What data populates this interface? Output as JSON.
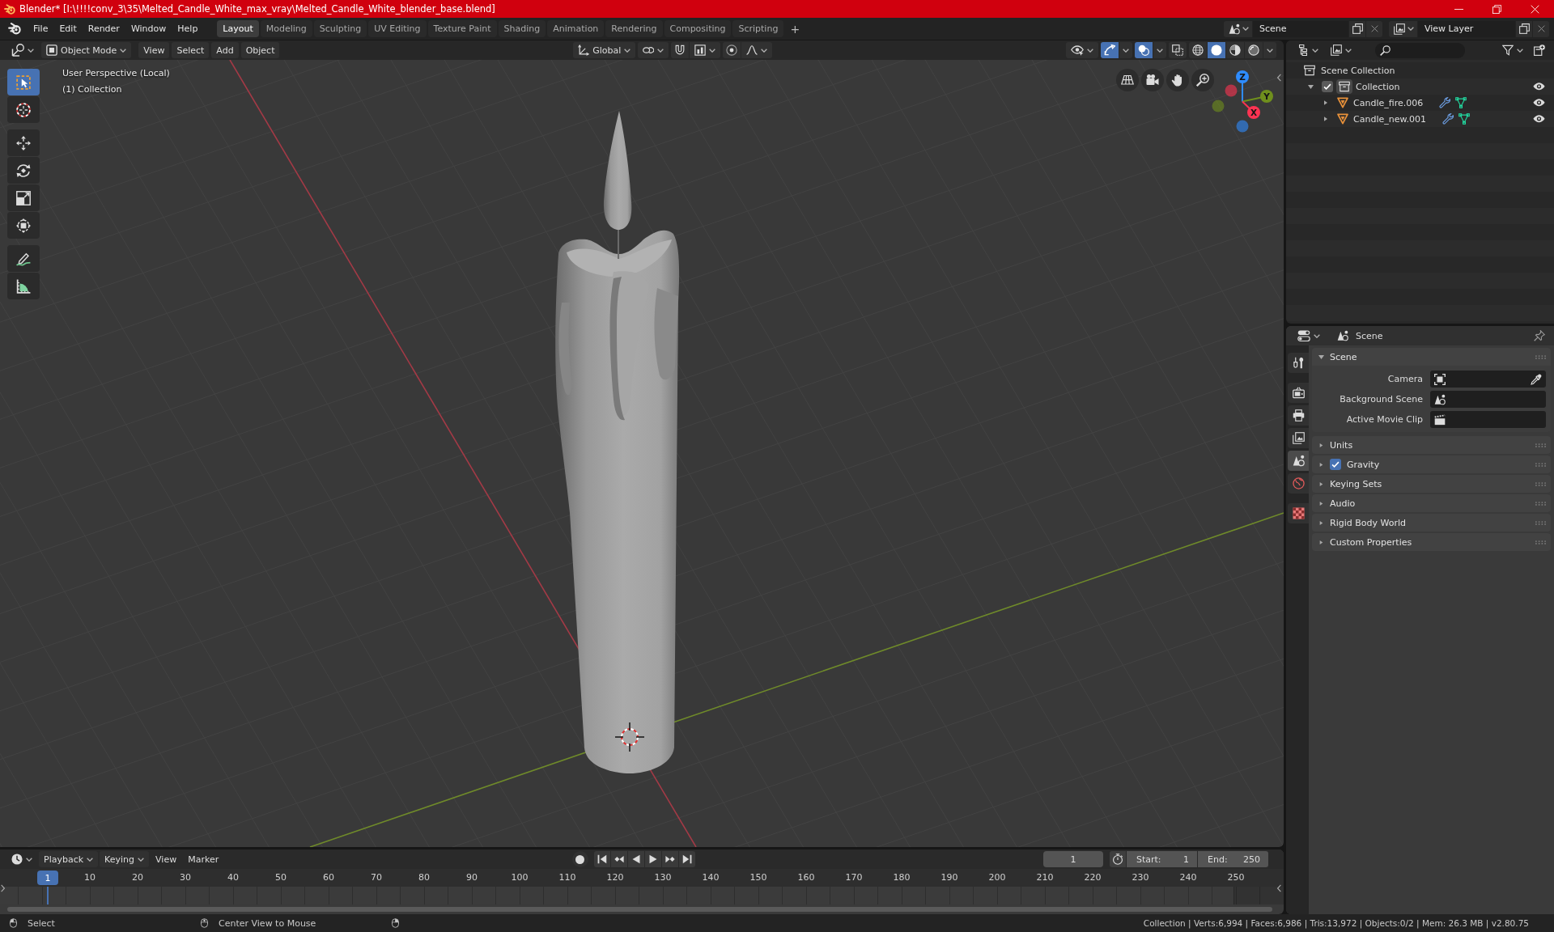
{
  "window": {
    "title": "Blender* [I:\\!!!!conv_3\\35\\Melted_Candle_White_max_vray\\Melted_Candle_White_blender_base.blend]"
  },
  "menu": [
    "File",
    "Edit",
    "Render",
    "Window",
    "Help"
  ],
  "workspaces": [
    {
      "label": "Layout",
      "selected": true
    },
    {
      "label": "Modeling",
      "selected": false
    },
    {
      "label": "Sculpting",
      "selected": false
    },
    {
      "label": "UV Editing",
      "selected": false
    },
    {
      "label": "Texture Paint",
      "selected": false
    },
    {
      "label": "Shading",
      "selected": false
    },
    {
      "label": "Animation",
      "selected": false
    },
    {
      "label": "Rendering",
      "selected": false
    },
    {
      "label": "Compositing",
      "selected": false
    },
    {
      "label": "Scripting",
      "selected": false
    }
  ],
  "add_workspace": "+",
  "scene": {
    "value": "Scene"
  },
  "view_layer": {
    "value": "View Layer"
  },
  "viewport": {
    "header": {
      "mode": "Object Mode",
      "menus": [
        "View",
        "Select",
        "Add",
        "Object"
      ],
      "orientation": "Global",
      "gizmos": {
        "on": true
      },
      "overlays": {
        "on": true
      },
      "xray": {
        "on": false
      },
      "shading": [
        {
          "kind": "wireframe",
          "selected": false
        },
        {
          "kind": "solid",
          "selected": true
        },
        {
          "kind": "material",
          "selected": false
        },
        {
          "kind": "rendered",
          "selected": false
        }
      ]
    },
    "info": [
      "User Perspective (Local)",
      "(1) Collection"
    ],
    "tool_groups": [
      [
        {
          "kind": "select",
          "selected": true
        },
        {
          "kind": "cursor",
          "selected": false
        }
      ],
      [
        {
          "kind": "move",
          "selected": false
        },
        {
          "kind": "rotate",
          "selected": false
        },
        {
          "kind": "scale",
          "selected": false
        },
        {
          "kind": "transform",
          "selected": false
        }
      ],
      [
        {
          "kind": "annotate",
          "selected": false
        },
        {
          "kind": "measure",
          "selected": false
        }
      ]
    ],
    "navigation": [
      {
        "kind": "grid"
      },
      {
        "kind": "camera"
      },
      {
        "kind": "pan"
      },
      {
        "kind": "zoom"
      }
    ],
    "gizmo_axes": [
      {
        "label": "Z",
        "color": "#2e8cff"
      },
      {
        "label": "Y",
        "color": "#6f8f1d"
      },
      {
        "label": "X",
        "color": "#ff3352"
      }
    ]
  },
  "outliner": {
    "root": "Scene Collection",
    "collections": [
      {
        "label": "Collection",
        "checked": true,
        "expanded": true,
        "visible": true,
        "children": [
          {
            "label": "Candle_fire.006",
            "expanded": false,
            "visible": true
          },
          {
            "label": "Candle_new.001",
            "expanded": false,
            "visible": true
          }
        ]
      }
    ]
  },
  "properties": {
    "context": "Scene",
    "tab_groups": [
      [
        {
          "kind": "tool",
          "selected": false
        }
      ],
      [
        {
          "kind": "render",
          "selected": false
        },
        {
          "kind": "output",
          "selected": false
        },
        {
          "kind": "view_layer",
          "selected": false
        },
        {
          "kind": "scene",
          "selected": true
        },
        {
          "kind": "world",
          "selected": false
        }
      ],
      [
        {
          "kind": "texture",
          "selected": false
        }
      ]
    ],
    "panels": [
      {
        "title": "Scene",
        "kind": "plain",
        "expanded": true,
        "fields": [
          {
            "label": "Camera",
            "kind": "camera"
          },
          {
            "label": "Background Scene",
            "kind": "scene"
          },
          {
            "label": "Active Movie Clip",
            "kind": "clip"
          }
        ]
      },
      {
        "title": "Units",
        "kind": "plain",
        "expanded": false
      },
      {
        "title": "Gravity",
        "kind": "checkbox",
        "checked": true,
        "expanded": false
      },
      {
        "title": "Keying Sets",
        "kind": "plain",
        "expanded": false
      },
      {
        "title": "Audio",
        "kind": "plain",
        "expanded": false
      },
      {
        "title": "Rigid Body World",
        "kind": "plain",
        "expanded": false
      },
      {
        "title": "Custom Properties",
        "kind": "plain",
        "expanded": false
      }
    ]
  },
  "timeline": {
    "menus": [
      {
        "label": "Playback",
        "kind": "dropdown"
      },
      {
        "label": "Keying",
        "kind": "dropdown"
      },
      {
        "label": "View",
        "kind": "menu"
      },
      {
        "label": "Marker",
        "kind": "menu"
      }
    ],
    "frame": "1",
    "start": {
      "label": "Start:",
      "value": "1"
    },
    "end": {
      "label": "End:",
      "value": "250"
    },
    "playhead": "1",
    "ruler": [
      "10",
      "20",
      "30",
      "40",
      "50",
      "60",
      "70",
      "80",
      "90",
      "100",
      "110",
      "120",
      "130",
      "140",
      "150",
      "160",
      "170",
      "180",
      "190",
      "200",
      "210",
      "220",
      "230",
      "240",
      "250"
    ]
  },
  "status_bar": {
    "hints": [
      "Select",
      "Center View to Mouse"
    ],
    "stats": "Collection | Verts:6,994 | Faces:6,986 | Tris:13,972 | Objects:0/2 | Mem: 26.3 MB | v2.80.75"
  }
}
